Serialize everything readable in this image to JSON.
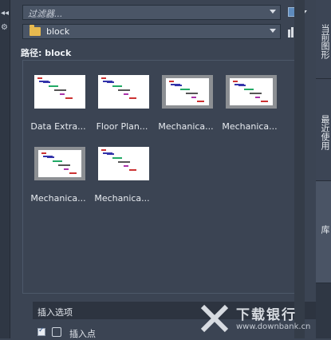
{
  "filter": {
    "placeholder": "过滤器..."
  },
  "folder": {
    "value": "block"
  },
  "path": {
    "label": "路径: block"
  },
  "blocks": [
    {
      "name": "Data Extra...",
      "style": "white"
    },
    {
      "name": "Floor Plan...",
      "style": "white"
    },
    {
      "name": "Mechanica...",
      "style": "grey"
    },
    {
      "name": "Mechanica...",
      "style": "grey"
    },
    {
      "name": "Mechanica...",
      "style": "grey"
    },
    {
      "name": "Mechanica...",
      "style": "white"
    }
  ],
  "insert_options": {
    "title": "插入选项",
    "insert_point_label": "插入点",
    "insert_point_checked": true
  },
  "right_tabs": [
    "当前图形",
    "最近使用",
    "库"
  ],
  "watermark": {
    "brand": "下载银行",
    "url": "www.downbank.cn"
  },
  "colors": {
    "panel_bg": "#3b4453",
    "tab_bg": "#2f3744",
    "accent": "#5e8bbd",
    "folder": "#e6b94f"
  }
}
